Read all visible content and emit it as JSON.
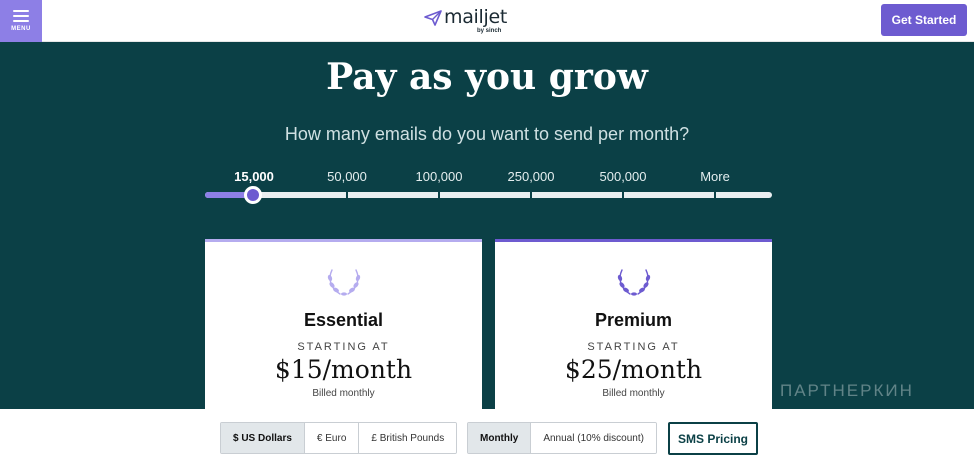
{
  "header": {
    "menu_label": "MENU",
    "logo_text": "mailjet",
    "logo_sub": "by sinch",
    "cta_label": "Get Started"
  },
  "hero": {
    "title": "Pay as you grow",
    "subtitle": "How many emails do you want to send per month?"
  },
  "slider": {
    "options": [
      "15,000",
      "50,000",
      "100,000",
      "250,000",
      "500,000",
      "More"
    ],
    "selected_index": 0
  },
  "plans": [
    {
      "name": "Essential",
      "starting_label": "STARTING AT",
      "price": "$15/month",
      "billing": "Billed monthly"
    },
    {
      "name": "Premium",
      "starting_label": "STARTING AT",
      "price": "$25/month",
      "billing": "Billed monthly"
    }
  ],
  "currency": {
    "options": [
      "$ US Dollars",
      "€ Euro",
      "£ British Pounds"
    ],
    "selected": "$ US Dollars"
  },
  "billing_period": {
    "options": [
      "Monthly",
      "Annual (10% discount)"
    ],
    "selected": "Monthly"
  },
  "sms_button_label": "SMS Pricing",
  "watermark_text": "ПАРТНЕРКИН",
  "colors": {
    "primary": "#6d5bd0",
    "accent_light": "#8d7fe6",
    "background": "#0b4046"
  }
}
